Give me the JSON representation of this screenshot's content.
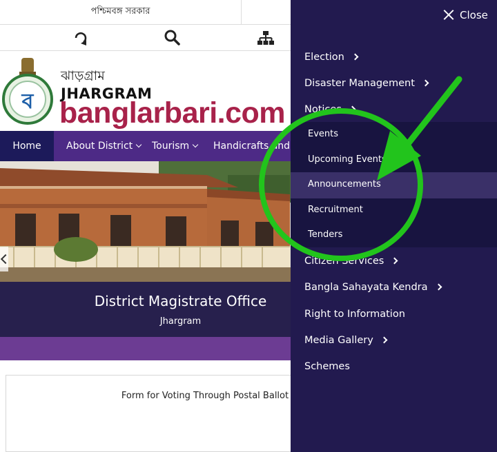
{
  "site": {
    "top_bar": {
      "govt_label": "পশ্চিমবঙ্গ সরকার"
    },
    "icons": [
      "refresh-icon",
      "search-icon",
      "sitemap-icon"
    ],
    "brand": {
      "name_bn": "ঝাড়গ্রাম",
      "name_en": "JHARGRAM",
      "wordmark": "banglarbari.com"
    },
    "nav": [
      "Home",
      "About District",
      "Tourism",
      "Handicrafts and H"
    ],
    "banner": {
      "title": "District Magistrate Office",
      "subtitle": "Jhargram"
    },
    "card": {
      "text": "Form for Voting Through Postal Ballot"
    }
  },
  "panel": {
    "close_label": "Close",
    "menu": [
      {
        "label": "Election"
      },
      {
        "label": "Disaster Management"
      },
      {
        "label": "Notices"
      },
      {
        "label": "Citizen Services"
      },
      {
        "label": "Bangla Sahayata Kendra"
      },
      {
        "label": "Right to Information"
      },
      {
        "label": "Media Gallery"
      },
      {
        "label": "Schemes"
      }
    ],
    "submenu": [
      {
        "label": "Events"
      },
      {
        "label": "Upcoming Events"
      },
      {
        "label": "Announcements"
      },
      {
        "label": "Recruitment"
      },
      {
        "label": "Tenders"
      }
    ]
  },
  "colors": {
    "panel_bg": "#221a4f",
    "nav_bg": "#4d2a86",
    "brand_accent": "#a8224a",
    "annotation": "#22c41c"
  }
}
